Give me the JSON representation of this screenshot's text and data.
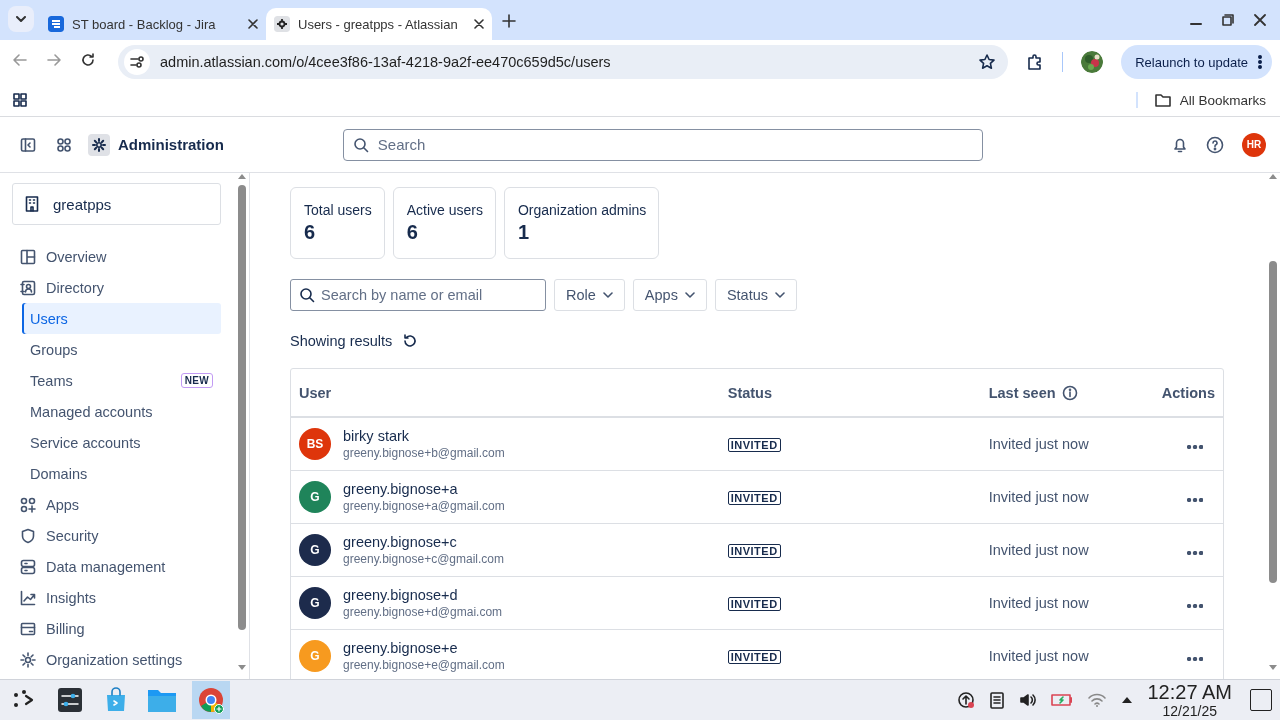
{
  "browser": {
    "tabs": [
      {
        "title": "ST board - Backlog - Jira",
        "selected": false
      },
      {
        "title": "Users - greatpps - Atlassian",
        "selected": true
      }
    ],
    "address": "admin.atlassian.com/o/4cee3f86-13af-4218-9a2f-ee470c659d5c/users",
    "relaunch_button": "Relaunch to update",
    "bookmarks": "All Bookmarks"
  },
  "app": {
    "title": "Administration",
    "search_placeholder": "Search",
    "user_initials": "HR"
  },
  "sidebar": {
    "org": "greatpps",
    "items": [
      {
        "label": "Overview",
        "selected": false
      },
      {
        "label": "Directory",
        "selected": false,
        "children": [
          {
            "label": "Users",
            "selected": true
          },
          {
            "label": "Groups",
            "selected": false
          },
          {
            "label": "Teams",
            "selected": false,
            "badge": "NEW"
          },
          {
            "label": "Managed accounts",
            "selected": false
          },
          {
            "label": "Service accounts",
            "selected": false
          },
          {
            "label": "Domains",
            "selected": false
          }
        ]
      },
      {
        "label": "Apps",
        "selected": false
      },
      {
        "label": "Security",
        "selected": false
      },
      {
        "label": "Data management",
        "selected": false
      },
      {
        "label": "Insights",
        "selected": false
      },
      {
        "label": "Billing",
        "selected": false
      },
      {
        "label": "Organization settings",
        "selected": false
      }
    ]
  },
  "stats": [
    {
      "label": "Total users",
      "value": "6"
    },
    {
      "label": "Active users",
      "value": "6"
    },
    {
      "label": "Organization admins",
      "value": "1"
    }
  ],
  "filters": {
    "search_placeholder": "Search by name or email",
    "dropdowns": [
      "Role",
      "Apps",
      "Status"
    ]
  },
  "results_label": "Showing results",
  "table": {
    "columns": [
      "User",
      "Status",
      "Last seen",
      "Actions"
    ],
    "rows": [
      {
        "initials": "BS",
        "color": "#de350b",
        "name": "birky stark",
        "email": "greeny.bignose+b@gmail.com",
        "status": "INVITED",
        "last_seen": "Invited just now"
      },
      {
        "initials": "G",
        "color": "#1f845a",
        "name": "greeny.bignose+a",
        "email": "greeny.bignose+a@gmail.com",
        "status": "INVITED",
        "last_seen": "Invited just now"
      },
      {
        "initials": "G",
        "color": "#1d2b4c",
        "name": "greeny.bignose+c",
        "email": "greeny.bignose+c@gmail.com",
        "status": "INVITED",
        "last_seen": "Invited just now"
      },
      {
        "initials": "G",
        "color": "#1d2b4c",
        "name": "greeny.bignose+d",
        "email": "greeny.bignose+d@gmai.com",
        "status": "INVITED",
        "last_seen": "Invited just now"
      },
      {
        "initials": "G",
        "color": "#f79a1f",
        "name": "greeny.bignose+e",
        "email": "greeny.bignose+e@gmail.com",
        "status": "INVITED",
        "last_seen": "Invited just now"
      }
    ]
  },
  "taskbar": {
    "time": "12:27 AM",
    "date": "12/21/25"
  }
}
